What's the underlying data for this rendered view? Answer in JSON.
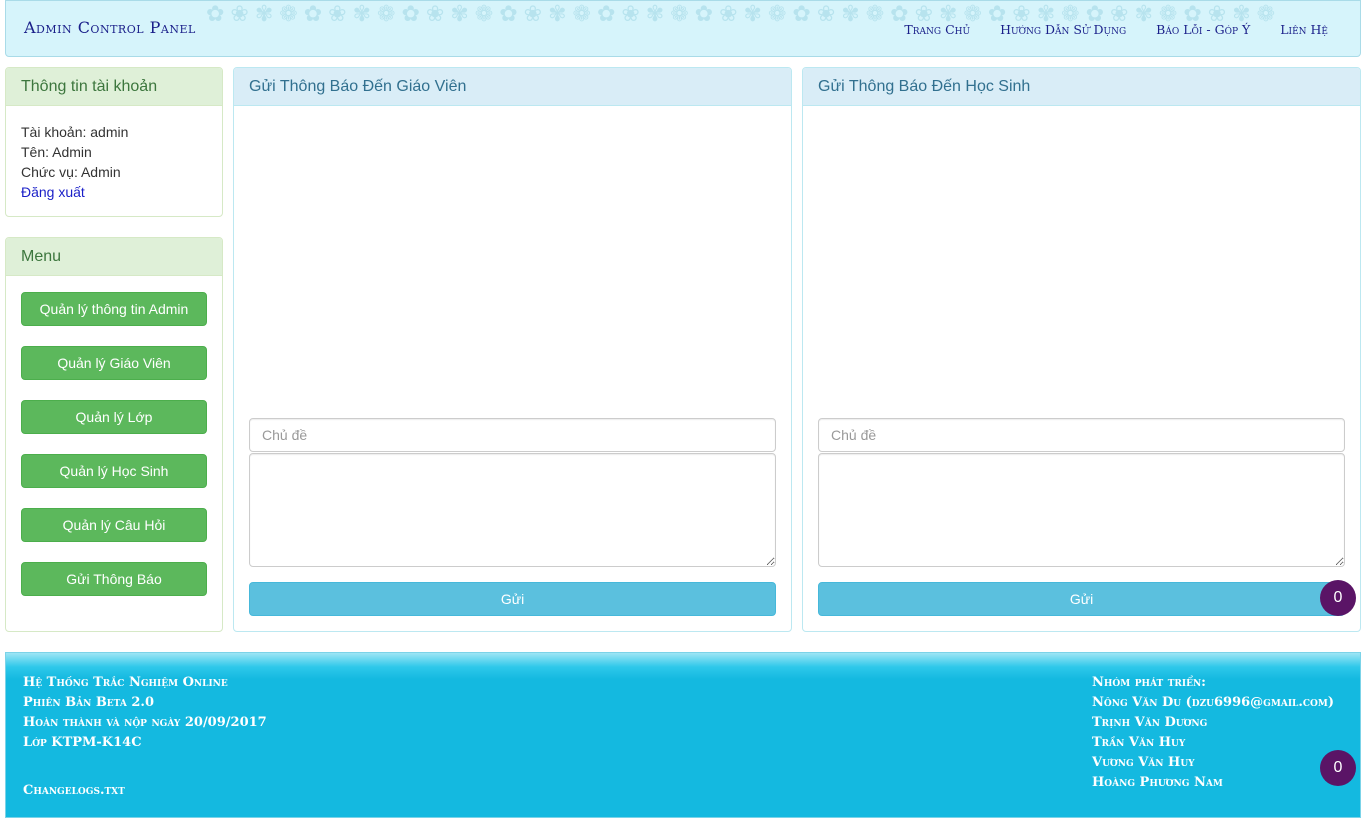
{
  "header": {
    "brand": "Admin Control Panel",
    "nav": [
      "Trang Chủ",
      "Hướng Dẫn Sử Dụng",
      "Báo Lỗi - Góp Ý",
      "Liên Hệ"
    ]
  },
  "account": {
    "title": "Thông tin tài khoản",
    "username_line": "Tài khoản: admin",
    "name_line": "Tên: Admin",
    "role_line": "Chức vụ: Admin",
    "logout": "Đăng xuất"
  },
  "menu": {
    "title": "Menu",
    "items": [
      "Quản lý thông tin Admin",
      "Quản lý Giáo Viên",
      "Quản lý Lớp",
      "Quản lý Học Sinh",
      "Quản lý Câu Hỏi",
      "Gửi Thông Báo"
    ]
  },
  "teacher_notice": {
    "title": "Gửi Thông Báo Đến Giáo Viên",
    "subject_placeholder": "Chủ đề",
    "send": "Gửi"
  },
  "student_notice": {
    "title": "Gửi Thông Báo Đến Học Sinh",
    "subject_placeholder": "Chủ đề",
    "send": "Gửi"
  },
  "footer": {
    "left": [
      "Hệ Thống Trắc Nghiệm Online",
      "Phiên Bản Beta 2.0",
      "Hoàn thành và nộp ngày 20/09/2017",
      "Lớp KTPM-K14C"
    ],
    "changelog": "Changelogs.txt",
    "right": [
      "Nhóm phát triển:",
      "Nông Văn Du (dzu6996@gmail.com)",
      "Trịnh Văn Dương",
      "Trần Văn Huy",
      "Vương Văn Huy",
      "Hoàng Phương Nam"
    ]
  },
  "badges": [
    "0",
    "0"
  ],
  "colors": {
    "header_bg": "#d6f4fb",
    "brand_text": "#1a1f8a",
    "success_btn": "#5cb85c",
    "info_btn": "#5bc0de",
    "footer_bg": "#14b9e0",
    "badge_bg": "#5a1466"
  }
}
